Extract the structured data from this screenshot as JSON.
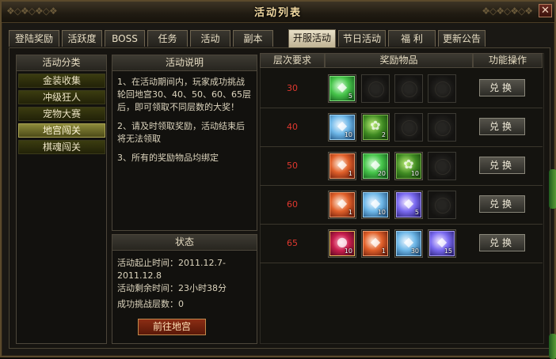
{
  "window": {
    "title": "活动列表",
    "close_label": "✕"
  },
  "tabs": [
    {
      "label": "登陆奖励",
      "active": false
    },
    {
      "label": "活跃度",
      "active": false
    },
    {
      "label": "BOSS",
      "active": false
    },
    {
      "label": "任务",
      "active": false
    },
    {
      "label": "活动",
      "active": false
    },
    {
      "label": "副本",
      "active": false
    },
    {
      "label": "开服活动",
      "active": true
    },
    {
      "label": "节日活动",
      "active": false
    },
    {
      "label": "福 利",
      "active": false
    },
    {
      "label": "更新公告",
      "active": false
    }
  ],
  "categories": {
    "header": "活动分类",
    "items": [
      {
        "label": "金装收集",
        "selected": false
      },
      {
        "label": "冲级狂人",
        "selected": false
      },
      {
        "label": "宠物大赛",
        "selected": false
      },
      {
        "label": "地宫闯关",
        "selected": true
      },
      {
        "label": "棋魂闯关",
        "selected": false
      }
    ]
  },
  "description": {
    "header": "活动说明",
    "paragraphs": [
      "1、在活动期间内，玩家成功挑战轮回地宫30、40、50、60、65层后，即可领取不同层数的大奖！",
      "2、请及时领取奖励，活动结束后将无法领取",
      "3、所有的奖励物品均绑定"
    ]
  },
  "status": {
    "header": "状态",
    "start_time": "活动起止时间：2011.12.7-2011.12.8",
    "remaining": "活动剩余时间：23小时38分",
    "cleared": "成功挑战层数：0",
    "go_button": "前往地宫"
  },
  "reward_table": {
    "headers": {
      "level": "层次要求",
      "items": "奖励物品",
      "action": "功能操作"
    },
    "exchange_label": "兑换",
    "rows": [
      {
        "level": "30",
        "items": [
          {
            "type": "green-crystal",
            "count": "5"
          },
          null,
          null,
          null
        ]
      },
      {
        "level": "40",
        "items": [
          {
            "type": "blue-crystal",
            "count": "10"
          },
          {
            "type": "green-herb",
            "count": "2"
          },
          null,
          null
        ]
      },
      {
        "level": "50",
        "items": [
          {
            "type": "red-crystal",
            "count": "1"
          },
          {
            "type": "green-crystal",
            "count": "20"
          },
          {
            "type": "green-herb",
            "count": "10"
          },
          null
        ]
      },
      {
        "level": "60",
        "items": [
          {
            "type": "red-crystal",
            "count": "1"
          },
          {
            "type": "blue-crystal",
            "count": "10"
          },
          {
            "type": "violet-crystal",
            "count": "5"
          },
          null
        ]
      },
      {
        "level": "65",
        "items": [
          {
            "type": "ruby-orb",
            "count": "10"
          },
          {
            "type": "red-crystal",
            "count": "1"
          },
          {
            "type": "blue-crystal",
            "count": "30"
          },
          {
            "type": "violet-crystal",
            "count": "15"
          }
        ]
      }
    ]
  },
  "colors": {
    "level_text": "#e0382f",
    "title_text": "#f1d8a0",
    "active_tab": "#e8e0c8",
    "selected_category": "#8c8a3a"
  }
}
